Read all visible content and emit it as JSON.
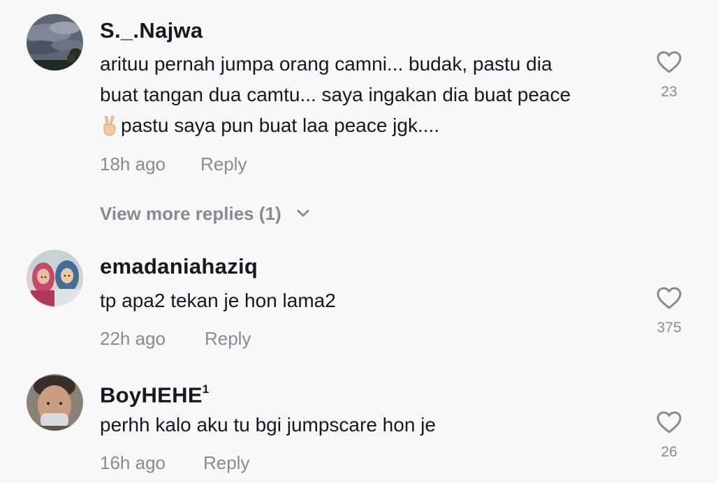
{
  "comments": [
    {
      "username": "S._.Najwa",
      "text_line1": "arituu pernah jumpa orang camni... budak, pastu dia",
      "text_line2": "buat tangan dua camtu... saya ingakan dia buat peace",
      "emoji": "✌",
      "text_line3": "pastu saya pun buat laa peace jgk....",
      "time": "18h ago",
      "reply_label": "Reply",
      "likes": "23",
      "view_more": "View more replies (1)"
    },
    {
      "username": "emadaniahaziq",
      "text": "tp apa2 tekan je hon lama2",
      "time": "22h ago",
      "reply_label": "Reply",
      "likes": "375"
    },
    {
      "username": "BoyHEHE",
      "username_sup": "1",
      "text": "perhh kalo aku tu bgi jumpscare hon je",
      "time": "16h ago",
      "reply_label": "Reply",
      "likes": "26"
    }
  ],
  "icons": {
    "like": "heart-outline-icon",
    "expand": "chevron-down-icon"
  }
}
